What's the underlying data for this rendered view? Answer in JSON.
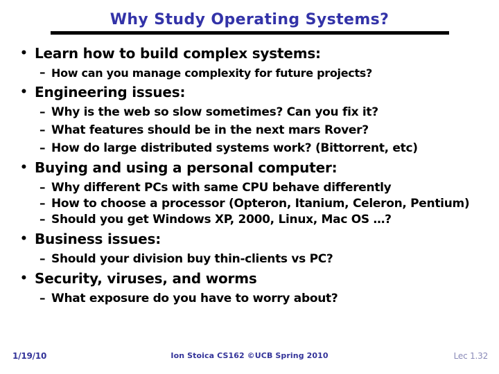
{
  "slide": {
    "title": "Why Study Operating Systems?",
    "title_color": "#3333a8",
    "rule_color": "#000000",
    "background": "#ffffff",
    "body_color": "#000000",
    "bullet_marker": "•",
    "dash_marker": "–",
    "outline": [
      {
        "level": 1,
        "text": "Learn how to build complex systems:",
        "children": [
          {
            "level": 2,
            "text": "How can you manage complexity for future projects?",
            "size": "small"
          }
        ]
      },
      {
        "level": 1,
        "text": "Engineering issues:",
        "children": [
          {
            "level": 2,
            "text": "Why is the web so slow sometimes? Can you fix it?",
            "size": "normal"
          },
          {
            "level": 2,
            "text": "What features should be in the next mars Rover?",
            "size": "normal"
          },
          {
            "level": 2,
            "text": "How do large distributed systems work? (Bittorrent, etc)",
            "size": "normal"
          }
        ]
      },
      {
        "level": 1,
        "text": "Buying and using a personal computer:",
        "children": [
          {
            "level": 2,
            "text": "Why different PCs with same CPU behave differently",
            "size": "normal"
          },
          {
            "level": 2,
            "text": "How to choose a processor (Opteron, Itanium, Celeron, Pentium)",
            "size": "normal",
            "wrapped": true
          },
          {
            "level": 2,
            "text": "Should you get Windows XP, 2000, Linux, Mac OS …?",
            "size": "normal"
          }
        ]
      },
      {
        "level": 1,
        "text": "Business issues:",
        "children": [
          {
            "level": 2,
            "text": "Should your division buy thin-clients vs PC?",
            "size": "normal"
          }
        ]
      },
      {
        "level": 1,
        "text": "Security, viruses, and worms",
        "children": [
          {
            "level": 2,
            "text": "What exposure do you have to worry about?",
            "size": "normal"
          }
        ]
      }
    ]
  },
  "footer": {
    "date": "1/19/10",
    "center": "Ion Stoica CS162 ©UCB Spring 2010",
    "page": "Lec 1.32",
    "text_color": "#333399",
    "page_color": "#8a8ab8"
  }
}
